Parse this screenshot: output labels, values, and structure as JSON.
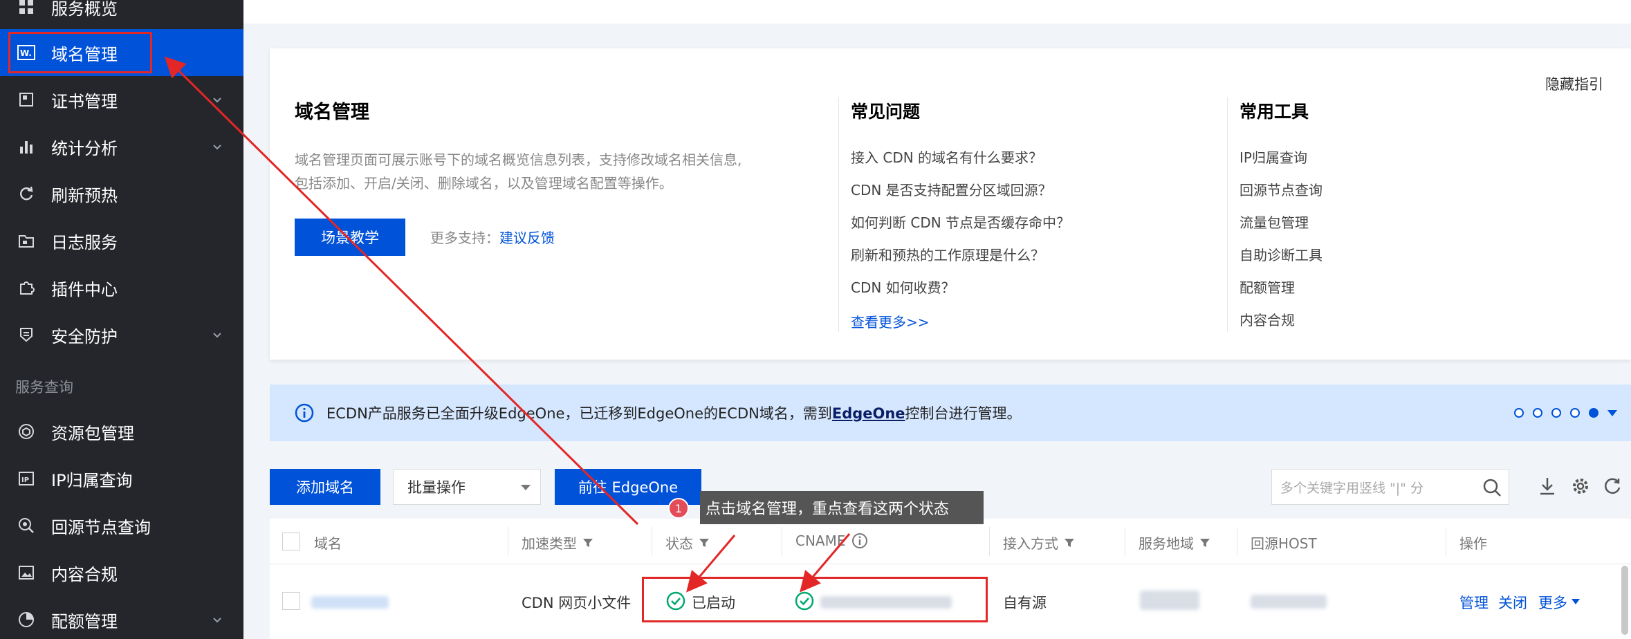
{
  "sidebar": {
    "items": [
      {
        "label": "服务概览",
        "icon": "grid-icon"
      },
      {
        "label": "域名管理",
        "icon": "domain-icon",
        "active": true
      },
      {
        "label": "证书管理",
        "icon": "certificate-icon",
        "has_children": true
      },
      {
        "label": "统计分析",
        "icon": "bar-chart-icon",
        "has_children": true
      },
      {
        "label": "刷新预热",
        "icon": "refresh-icon"
      },
      {
        "label": "日志服务",
        "icon": "folder-icon"
      },
      {
        "label": "插件中心",
        "icon": "puzzle-icon"
      },
      {
        "label": "安全防护",
        "icon": "shield-icon",
        "has_children": true
      }
    ],
    "section_label": "服务查询",
    "query_items": [
      {
        "label": "资源包管理",
        "icon": "package-icon"
      },
      {
        "label": "IP归属查询",
        "icon": "ip-icon"
      },
      {
        "label": "回源节点查询",
        "icon": "search-node-icon"
      },
      {
        "label": "内容合规",
        "icon": "image-icon"
      },
      {
        "label": "配额管理",
        "icon": "pie-icon",
        "has_children": true
      }
    ]
  },
  "guide": {
    "hide_label": "隐藏指引",
    "title": "域名管理",
    "desc_line1": "域名管理页面可展示账号下的域名概览信息列表，支持修改域名相关信息,",
    "desc_line2": "包括添加、开启/关闭、删除域名，以及管理域名配置等操作。",
    "scene_button": "场景教学",
    "more_support_label": "更多支持：",
    "feedback_link": "建议反馈",
    "faq_title": "常见问题",
    "faq": [
      "接入 CDN 的域名有什么要求？",
      "CDN 是否支持配置分区域回源？",
      "如何判断 CDN 节点是否缓存命中？",
      "刷新和预热的工作原理是什么？",
      "CDN 如何收费？"
    ],
    "see_more": "查看更多>>",
    "tools_title": "常用工具",
    "tools": [
      "IP归属查询",
      "回源节点查询",
      "流量包管理",
      "自助诊断工具",
      "配额管理",
      "内容合规"
    ]
  },
  "notice": {
    "text_before": "ECDN产品服务已全面升级EdgeOne，已迁移到EdgeOne的ECDN域名，需到",
    "edge_link": "EdgeOne",
    "text_after": "控制台进行管理。"
  },
  "toolbar": {
    "add_domain": "添加域名",
    "batch_select": "批量操作",
    "goto_edgeone": "前往 EdgeOne",
    "search_placeholder": "多个关键字用竖线 \"|\" 分"
  },
  "annotation": {
    "badge": "1",
    "tooltip": "点击域名管理，重点查看这两个状态"
  },
  "table": {
    "headers": {
      "domain": "域名",
      "accel_type": "加速类型",
      "status": "状态",
      "cname": "CNAME",
      "access": "接入方式",
      "region": "服务地域",
      "origin_host": "回源HOST",
      "ops": "操作"
    },
    "row": {
      "accel_type": "CDN 网页小文件",
      "status": "已启动",
      "access": "自有源",
      "ops": [
        "管理",
        "关闭",
        "更多"
      ]
    }
  },
  "colors": {
    "sidebar_bg": "#24262b",
    "primary": "#0052d9",
    "success": "#00a870",
    "annotation_red": "#e32626"
  }
}
